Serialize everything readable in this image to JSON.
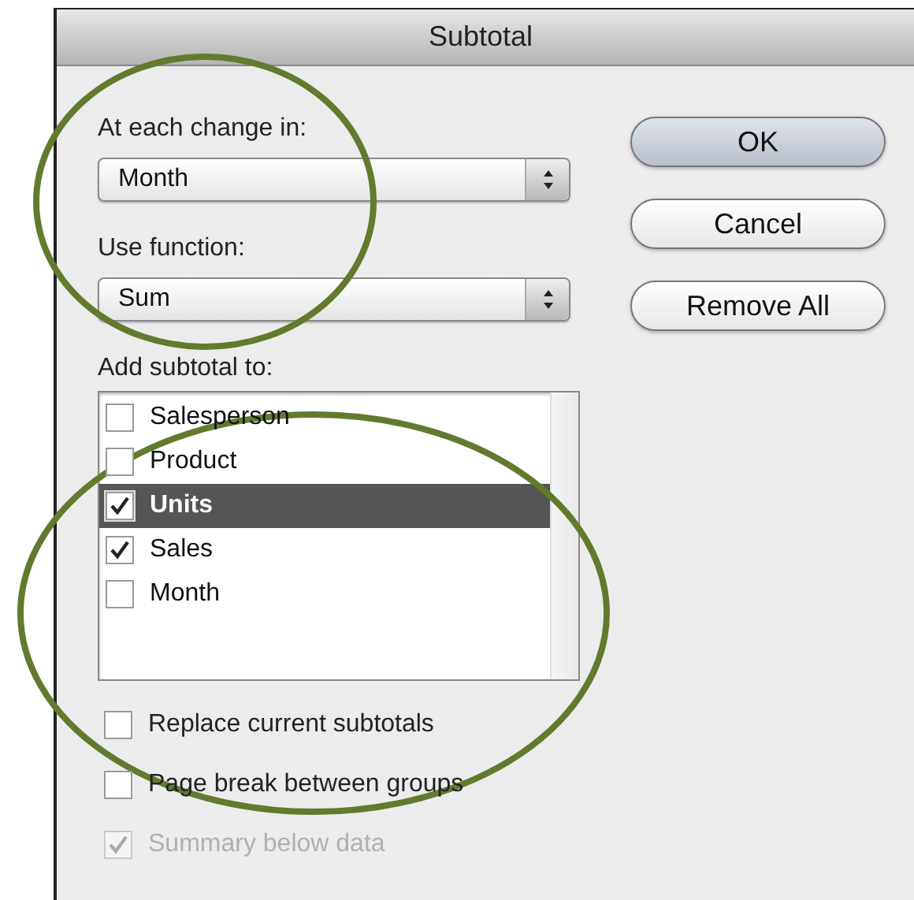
{
  "window": {
    "title": "Subtotal"
  },
  "fields": [
    {
      "label": "At each change in:",
      "value": "Month"
    },
    {
      "label": "Use function:",
      "value": "Sum"
    }
  ],
  "list": {
    "label": "Add subtotal to:",
    "items": [
      {
        "label": "Salesperson",
        "checked": false,
        "selected": false
      },
      {
        "label": "Product",
        "checked": false,
        "selected": false
      },
      {
        "label": "Units",
        "checked": true,
        "selected": true
      },
      {
        "label": "Sales",
        "checked": true,
        "selected": false
      },
      {
        "label": "Month",
        "checked": false,
        "selected": false
      }
    ]
  },
  "options": [
    {
      "label": "Replace current subtotals",
      "checked": false,
      "disabled": false
    },
    {
      "label": "Page break between groups",
      "checked": false,
      "disabled": false
    },
    {
      "label": "Summary below data",
      "checked": true,
      "disabled": true
    }
  ],
  "buttons": [
    {
      "label": "OK",
      "default": true
    },
    {
      "label": "Cancel",
      "default": false
    },
    {
      "label": "Remove All",
      "default": false
    }
  ]
}
